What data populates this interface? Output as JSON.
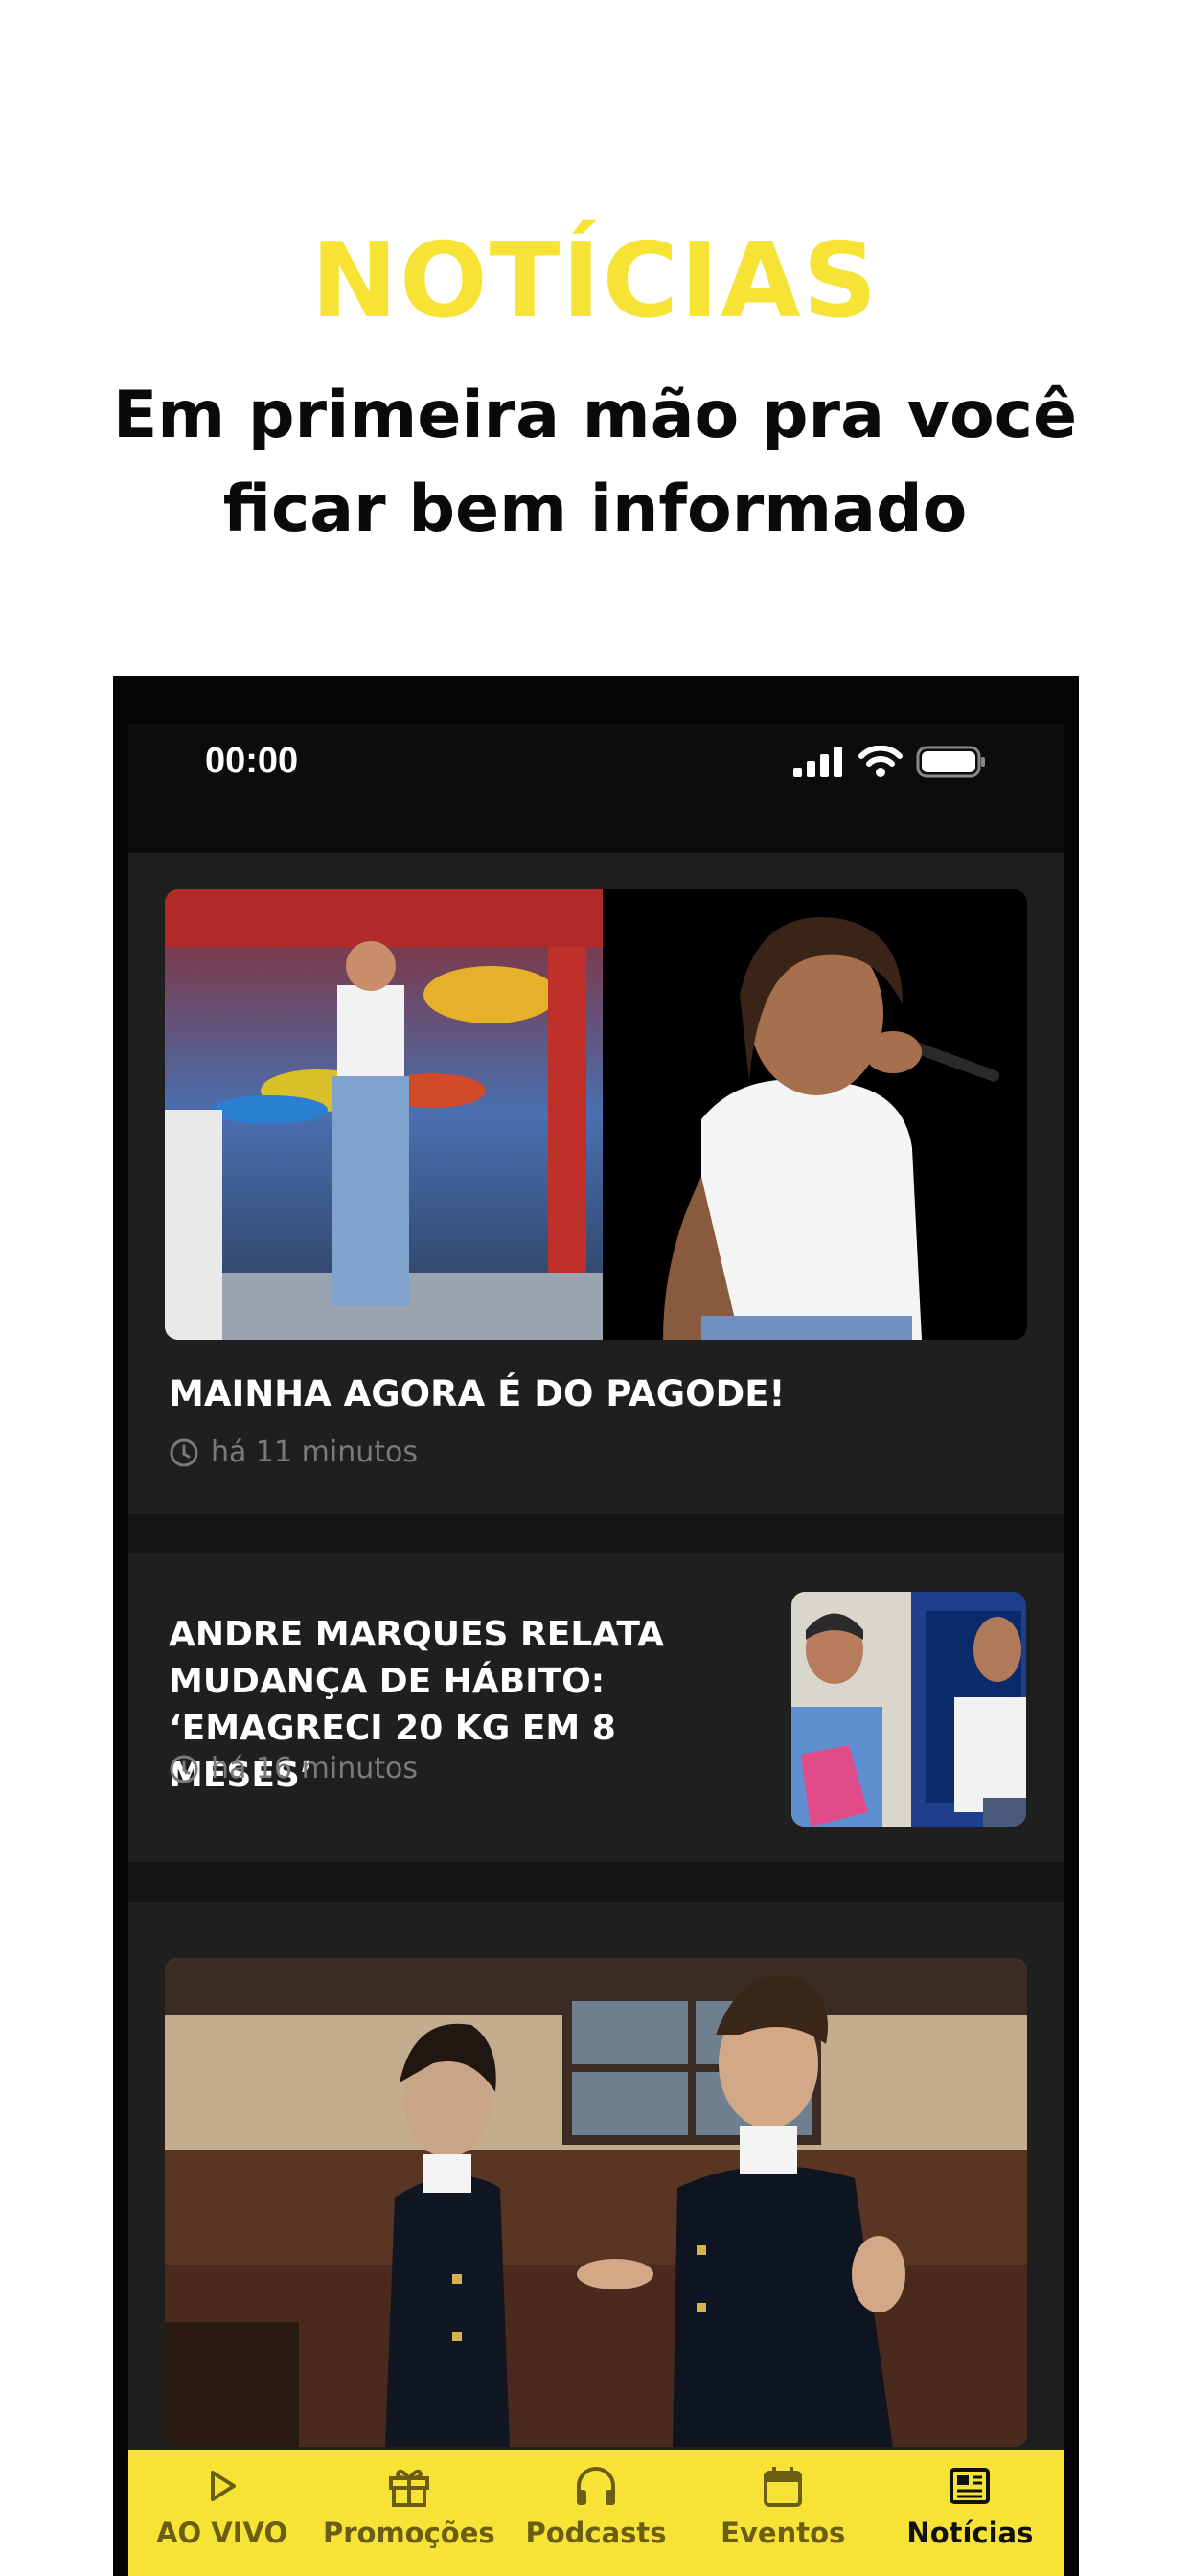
{
  "promo": {
    "headline": "NOTÍCIAS",
    "subheadline": "Em primeira mão pra você ficar bem informado"
  },
  "status_bar": {
    "time": "00:00"
  },
  "news": [
    {
      "title": "MAINHA AGORA É DO PAGODE!",
      "time": "há 11 minutos"
    },
    {
      "title": "ANDRE MARQUES RELATA MUDANÇA DE HÁBITO: ‘EMAGRECI 20 KG EM 8 MESES’",
      "time": "há 16 minutos"
    }
  ],
  "tabs": [
    {
      "label": "AO VIVO",
      "icon": "play-icon"
    },
    {
      "label": "Promoções",
      "icon": "gift-icon"
    },
    {
      "label": "Podcasts",
      "icon": "headphones-icon"
    },
    {
      "label": "Eventos",
      "icon": "calendar-icon"
    },
    {
      "label": "Notícias",
      "icon": "newspaper-icon",
      "active": true
    }
  ],
  "colors": {
    "accent": "#f6e335",
    "background": "#151515",
    "card": "#1f1f1f"
  }
}
